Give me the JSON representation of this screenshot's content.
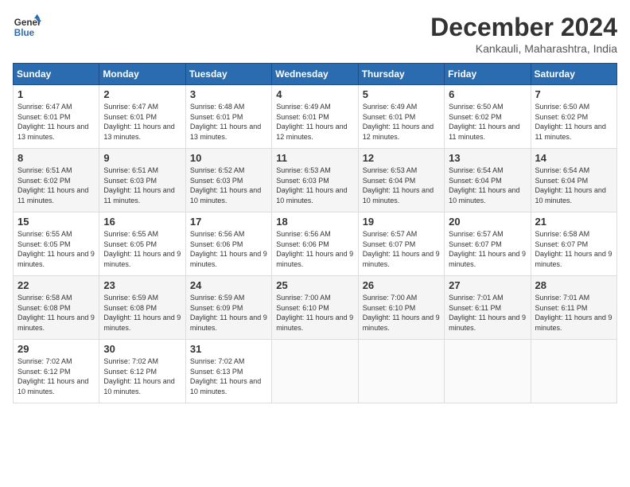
{
  "header": {
    "logo_line1": "General",
    "logo_line2": "Blue",
    "month": "December 2024",
    "location": "Kankauli, Maharashtra, India"
  },
  "weekdays": [
    "Sunday",
    "Monday",
    "Tuesday",
    "Wednesday",
    "Thursday",
    "Friday",
    "Saturday"
  ],
  "weeks": [
    [
      {
        "day": "1",
        "sunrise": "6:47 AM",
        "sunset": "6:01 PM",
        "daylight": "11 hours and 13 minutes."
      },
      {
        "day": "2",
        "sunrise": "6:47 AM",
        "sunset": "6:01 PM",
        "daylight": "11 hours and 13 minutes."
      },
      {
        "day": "3",
        "sunrise": "6:48 AM",
        "sunset": "6:01 PM",
        "daylight": "11 hours and 13 minutes."
      },
      {
        "day": "4",
        "sunrise": "6:49 AM",
        "sunset": "6:01 PM",
        "daylight": "11 hours and 12 minutes."
      },
      {
        "day": "5",
        "sunrise": "6:49 AM",
        "sunset": "6:01 PM",
        "daylight": "11 hours and 12 minutes."
      },
      {
        "day": "6",
        "sunrise": "6:50 AM",
        "sunset": "6:02 PM",
        "daylight": "11 hours and 11 minutes."
      },
      {
        "day": "7",
        "sunrise": "6:50 AM",
        "sunset": "6:02 PM",
        "daylight": "11 hours and 11 minutes."
      }
    ],
    [
      {
        "day": "8",
        "sunrise": "6:51 AM",
        "sunset": "6:02 PM",
        "daylight": "11 hours and 11 minutes."
      },
      {
        "day": "9",
        "sunrise": "6:51 AM",
        "sunset": "6:03 PM",
        "daylight": "11 hours and 11 minutes."
      },
      {
        "day": "10",
        "sunrise": "6:52 AM",
        "sunset": "6:03 PM",
        "daylight": "11 hours and 10 minutes."
      },
      {
        "day": "11",
        "sunrise": "6:53 AM",
        "sunset": "6:03 PM",
        "daylight": "11 hours and 10 minutes."
      },
      {
        "day": "12",
        "sunrise": "6:53 AM",
        "sunset": "6:04 PM",
        "daylight": "11 hours and 10 minutes."
      },
      {
        "day": "13",
        "sunrise": "6:54 AM",
        "sunset": "6:04 PM",
        "daylight": "11 hours and 10 minutes."
      },
      {
        "day": "14",
        "sunrise": "6:54 AM",
        "sunset": "6:04 PM",
        "daylight": "11 hours and 10 minutes."
      }
    ],
    [
      {
        "day": "15",
        "sunrise": "6:55 AM",
        "sunset": "6:05 PM",
        "daylight": "11 hours and 9 minutes."
      },
      {
        "day": "16",
        "sunrise": "6:55 AM",
        "sunset": "6:05 PM",
        "daylight": "11 hours and 9 minutes."
      },
      {
        "day": "17",
        "sunrise": "6:56 AM",
        "sunset": "6:06 PM",
        "daylight": "11 hours and 9 minutes."
      },
      {
        "day": "18",
        "sunrise": "6:56 AM",
        "sunset": "6:06 PM",
        "daylight": "11 hours and 9 minutes."
      },
      {
        "day": "19",
        "sunrise": "6:57 AM",
        "sunset": "6:07 PM",
        "daylight": "11 hours and 9 minutes."
      },
      {
        "day": "20",
        "sunrise": "6:57 AM",
        "sunset": "6:07 PM",
        "daylight": "11 hours and 9 minutes."
      },
      {
        "day": "21",
        "sunrise": "6:58 AM",
        "sunset": "6:07 PM",
        "daylight": "11 hours and 9 minutes."
      }
    ],
    [
      {
        "day": "22",
        "sunrise": "6:58 AM",
        "sunset": "6:08 PM",
        "daylight": "11 hours and 9 minutes."
      },
      {
        "day": "23",
        "sunrise": "6:59 AM",
        "sunset": "6:08 PM",
        "daylight": "11 hours and 9 minutes."
      },
      {
        "day": "24",
        "sunrise": "6:59 AM",
        "sunset": "6:09 PM",
        "daylight": "11 hours and 9 minutes."
      },
      {
        "day": "25",
        "sunrise": "7:00 AM",
        "sunset": "6:10 PM",
        "daylight": "11 hours and 9 minutes."
      },
      {
        "day": "26",
        "sunrise": "7:00 AM",
        "sunset": "6:10 PM",
        "daylight": "11 hours and 9 minutes."
      },
      {
        "day": "27",
        "sunrise": "7:01 AM",
        "sunset": "6:11 PM",
        "daylight": "11 hours and 9 minutes."
      },
      {
        "day": "28",
        "sunrise": "7:01 AM",
        "sunset": "6:11 PM",
        "daylight": "11 hours and 9 minutes."
      }
    ],
    [
      {
        "day": "29",
        "sunrise": "7:02 AM",
        "sunset": "6:12 PM",
        "daylight": "11 hours and 10 minutes."
      },
      {
        "day": "30",
        "sunrise": "7:02 AM",
        "sunset": "6:12 PM",
        "daylight": "11 hours and 10 minutes."
      },
      {
        "day": "31",
        "sunrise": "7:02 AM",
        "sunset": "6:13 PM",
        "daylight": "11 hours and 10 minutes."
      },
      null,
      null,
      null,
      null
    ]
  ]
}
